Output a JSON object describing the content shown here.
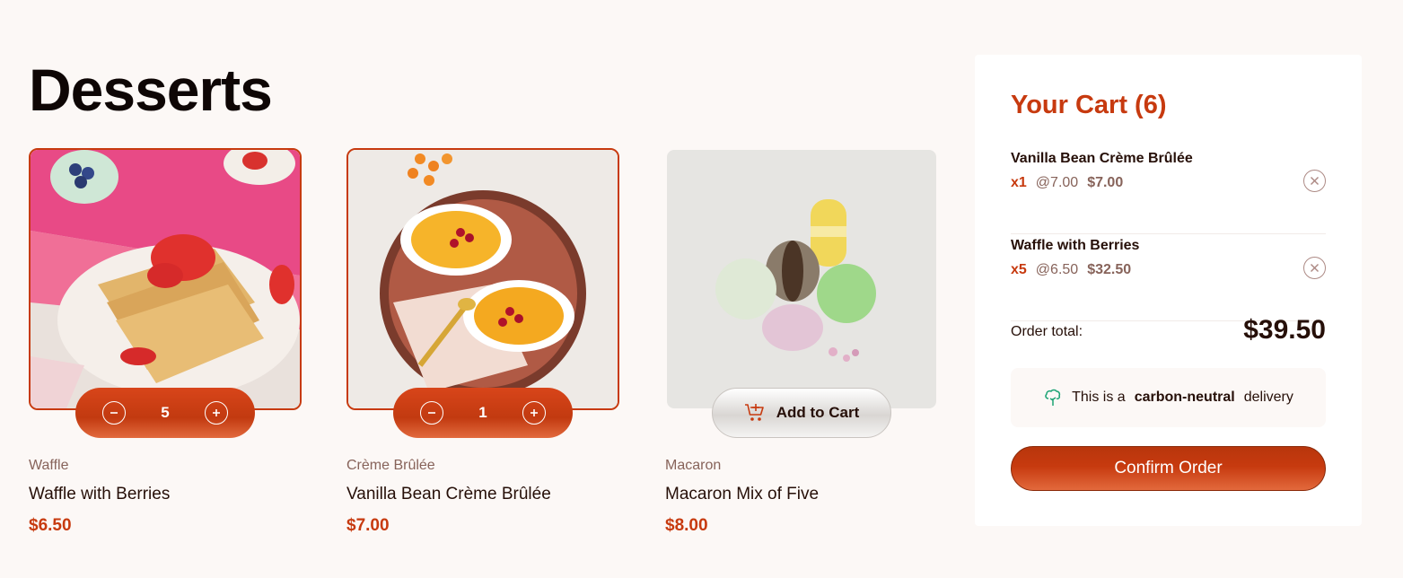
{
  "page": {
    "title": "Desserts"
  },
  "products": [
    {
      "category": "Waffle",
      "name": "Waffle with Berries",
      "price": "$6.50",
      "quantity": "5",
      "in_cart": true
    },
    {
      "category": "Crème Brûlée",
      "name": "Vanilla Bean Crème Brûlée",
      "price": "$7.00",
      "quantity": "1",
      "in_cart": true
    },
    {
      "category": "Macaron",
      "name": "Macaron Mix of Five",
      "price": "$8.00",
      "add_label": "Add to Cart",
      "in_cart": false
    }
  ],
  "cart": {
    "title": "Your Cart (6)",
    "items": [
      {
        "name": "Vanilla Bean Crème Brûlée",
        "qty": "x1",
        "unit_price": "@7.00",
        "line_total": "$7.00"
      },
      {
        "name": "Waffle with Berries",
        "qty": "x5",
        "unit_price": "@6.50",
        "line_total": "$32.50"
      }
    ],
    "order_total_label": "Order total:",
    "order_total": "$39.50",
    "carbon_prefix": "This is a",
    "carbon_bold": "carbon-neutral",
    "carbon_suffix": "delivery",
    "confirm_label": "Confirm Order"
  },
  "colors": {
    "accent": "#c73a0f",
    "text": "#260f08",
    "muted": "#87635a",
    "background": "#fcf8f6"
  },
  "icons": [
    "decrement-icon",
    "increment-icon",
    "add-to-cart-icon",
    "remove-item-icon",
    "carbon-neutral-tree-icon"
  ]
}
